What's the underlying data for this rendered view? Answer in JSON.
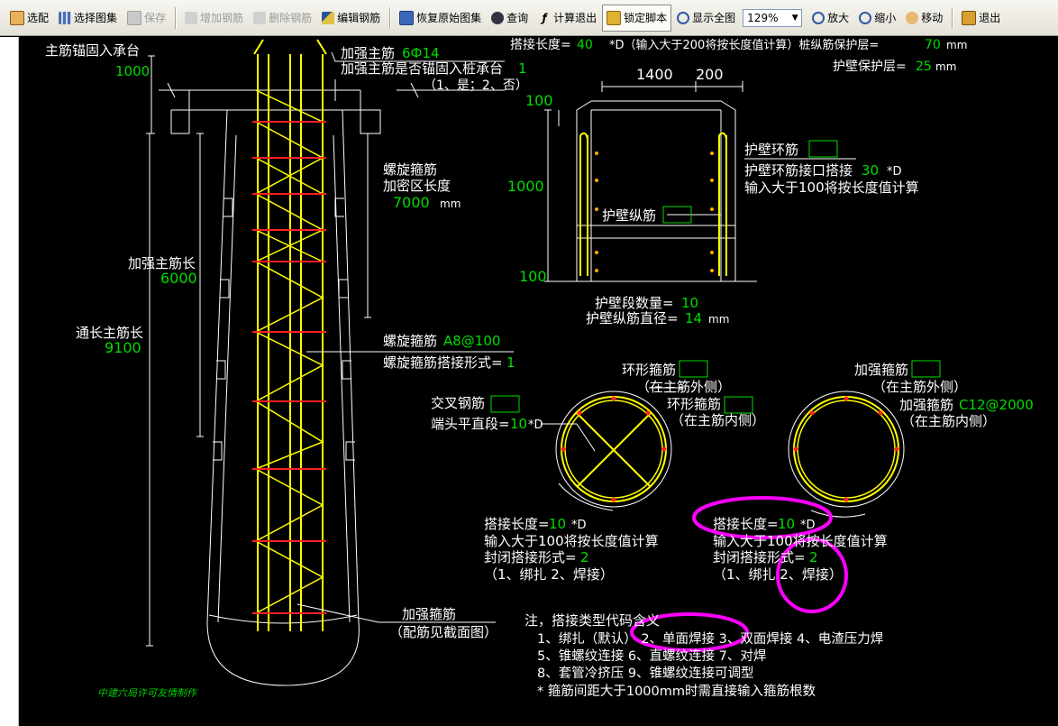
{
  "toolbar": {
    "select": "选配",
    "select_atlas": "选择图集",
    "save": "保存",
    "add_rebar": "增加钢筋",
    "delete_rebar": "删除钢筋",
    "edit_rebar": "编辑钢筋",
    "restore_atlas": "恢复原始图集",
    "query": "查询",
    "calc_exit": "计算退出",
    "lock_script": "锁定脚本",
    "show_all": "显示全图",
    "zoom_value": "129%",
    "zoom_in": "放大",
    "zoom_out": "缩小",
    "move": "移动",
    "exit": "退出"
  },
  "drawing": {
    "anchor_label": "主筋锚固入承台",
    "anchor_value": "1000",
    "reinforce_main_label": "加强主筋",
    "reinforce_main_value": "6Ф14",
    "anchor_q": "加强主筋是否锚固入桩承台",
    "anchor_q_value": "1",
    "anchor_q_opts": "（1、是；2、否）",
    "top_lap": "搭接长度=",
    "top_lap_value": "40",
    "top_lap_rest": "*D（输入大于200将按长度值计算）桩纵筋保护层=",
    "cover_value": "70",
    "cover_unit": "mm",
    "wall_cover_label": "护壁保护层=",
    "wall_cover_value": "25",
    "wall_cover_unit": "mm",
    "dim_1400": "1400",
    "dim_200": "200",
    "dim_100_top": "100",
    "dim_1000": "1000",
    "dim_100_bot": "100",
    "wall_ring_label": "护壁环筋",
    "wall_ring_lap": "护壁环筋接口搭接",
    "wall_ring_lap_value": "30",
    "wall_ring_lap_unit": "*D",
    "wall_ring_hint": "输入大于100将按长度值计算",
    "wall_long_label": "护壁纵筋",
    "wall_seg_label": "护壁段数量=",
    "wall_seg_value": "10",
    "wall_long_dia_label": "护壁纵筋直径=",
    "wall_long_dia_value": "14",
    "wall_long_dia_unit": "mm",
    "spiral_dense_l1": "螺旋箍筋",
    "spiral_dense_l2": "加密区长度",
    "spiral_dense_value": "7000",
    "spiral_dense_unit": "mm",
    "reinforce_len_label": "加强主筋长",
    "reinforce_len_value": "6000",
    "through_len_label": "通长主筋长",
    "through_len_value": "9100",
    "spiral_label": "螺旋箍筋",
    "spiral_value": "A8@100",
    "spiral_lap_label": "螺旋箍筋搭接形式=",
    "spiral_lap_value": "1",
    "ring_stirrup_label": "环形箍筋",
    "ring_outer": "（在主筋外侧）",
    "ring_stirrup_label2": "环形箍筋",
    "ring_inner": "（在主筋内侧）",
    "cross_label": "交叉钢筋",
    "end_straight": "端头平直段=",
    "end_straight_value": "10",
    "end_straight_unit": "*D",
    "reinforce_stirrup_label": "加强箍筋",
    "reinforce_outer": "（在主筋外侧）",
    "reinforce_stirrup_label2": "加强箍筋",
    "reinforce_stirrup_value": "C12@2000",
    "reinforce_inner": "（在主筋内侧）",
    "lap1": "搭接长度=",
    "lap1_value": "10",
    "lap1_unit": "*D",
    "lap1_hint": "输入大于100将按长度值计算",
    "close_lap1": "封闭搭接形式=",
    "close_lap1_value": "2",
    "close_opts1": "（1、绑扎  2、焊接）",
    "lap2": "搭接长度=",
    "lap2_value": "10",
    "lap2_unit": "*D",
    "lap2_hint": "输入大于100将按长度值计算",
    "close_lap2": "封闭搭接形式=",
    "close_lap2_value": "2",
    "close_opts2": "（1、绑扎  2、焊接）",
    "reinforce_bottom_label": "加强箍筋",
    "reinforce_bottom_note": "（配筋见截面图）",
    "note_title": "注，搭接类型代码含义",
    "note_l1": "1、绑扎（默认）   2、单面焊接   3、双面焊接    4、电渣压力焊",
    "note_l2": "5、锥螺纹连接    6、直螺纹连接    7、对焊",
    "note_l3": "8、套管冷挤压    9、锥螺纹连接可调型",
    "note_l4": "* 箍筋间距大于1000mm时需直接输入箍筋根数",
    "credit": "中建六局许可友情制作"
  },
  "colors": {
    "background": "#000000",
    "label": "#ffffff",
    "value": "#00dd00",
    "rebar": "#ffff00",
    "stirrup": "#ff2020",
    "outline": "#ffffff",
    "highlight": "#ff00ff"
  }
}
